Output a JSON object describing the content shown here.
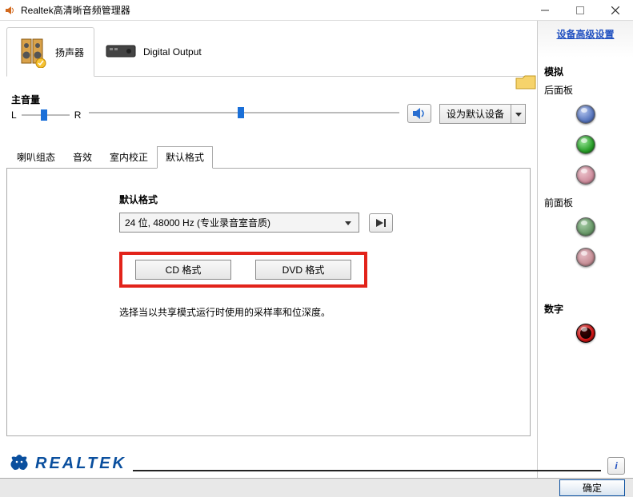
{
  "window": {
    "title": "Realtek高清晰音频管理器"
  },
  "device_tabs": {
    "speakers": "扬声器",
    "digital": "Digital Output"
  },
  "volume": {
    "label": "主音量",
    "L": "L",
    "R": "R",
    "set_default": "设为默认设备"
  },
  "inner_tabs": {
    "t0": "喇叭组态",
    "t1": "音效",
    "t2": "室内校正",
    "t3": "默认格式"
  },
  "format": {
    "title": "默认格式",
    "selected": "24 位, 48000 Hz (专业录音室音质)",
    "cd": "CD 格式",
    "dvd": "DVD 格式",
    "desc": "选择当以共享模式运行时使用的采样率和位深度。"
  },
  "right": {
    "adv_link": "设备高级设置",
    "analog": "模拟",
    "rear": "后面板",
    "front": "前面板",
    "digital": "数字"
  },
  "brand": "REALTEK",
  "info_label": "i",
  "ok": "确定"
}
